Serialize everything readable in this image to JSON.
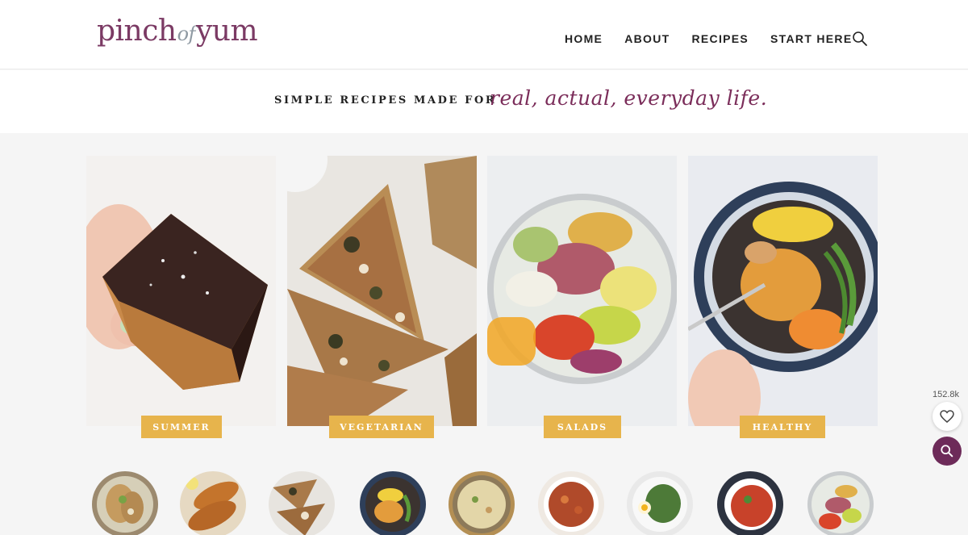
{
  "brand": {
    "logo_left": "pinch",
    "logo_mid": "of",
    "logo_right": "yum"
  },
  "nav": {
    "home": "HOME",
    "about": "ABOUT",
    "recipes": "RECIPES",
    "start_here": "START HERE"
  },
  "tagline": {
    "plain": "SIMPLE RECIPES MADE FOR",
    "script": "real, actual, everyday life."
  },
  "categories": [
    {
      "label": "SUMMER",
      "icon": "chocolate-bar-photo"
    },
    {
      "label": "VEGETARIAN",
      "icon": "pizza-photo"
    },
    {
      "label": "SALADS",
      "icon": "salad-bowl-photo"
    },
    {
      "label": "HEALTHY",
      "icon": "healthy-bowl-photo"
    }
  ],
  "save_widget": {
    "count": "152.8k"
  },
  "colors": {
    "brand_purple": "#7b2d5a",
    "badge_gold": "#e7b44c",
    "fab_purple": "#6d2b59"
  }
}
